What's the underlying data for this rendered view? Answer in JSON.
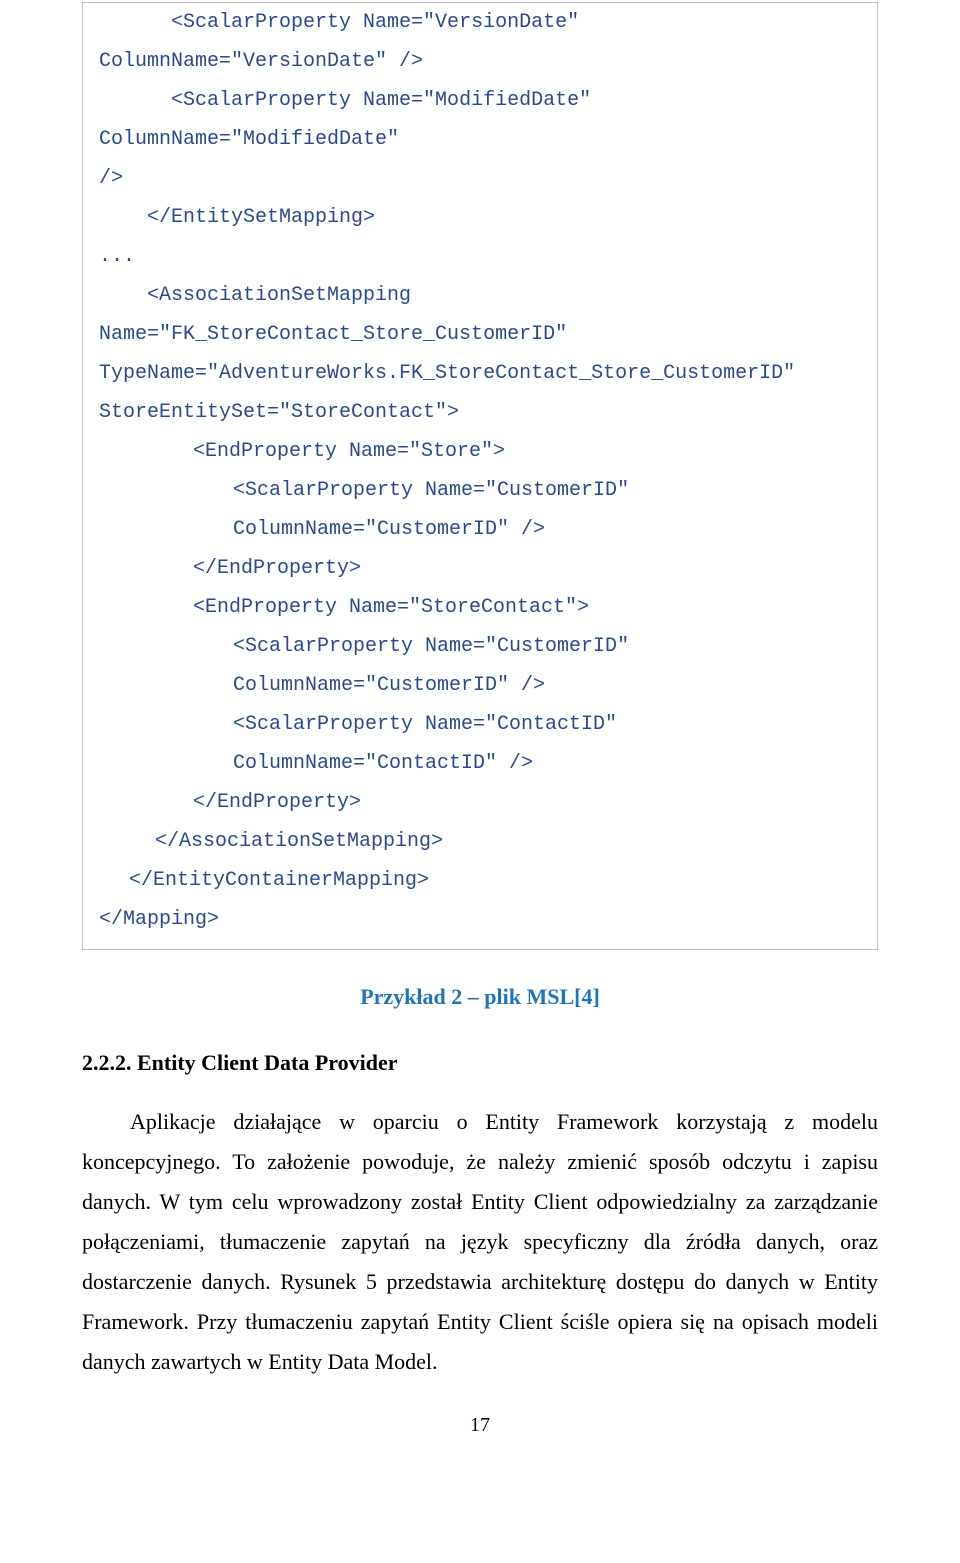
{
  "xml": {
    "l1": "      <ScalarProperty Name=\"VersionDate\" ColumnName=\"VersionDate\" />",
    "l2": "      <ScalarProperty Name=\"ModifiedDate\" ColumnName=\"ModifiedDate\"",
    "l3": "/>",
    "l4": "    </EntitySetMapping>",
    "l5": "...",
    "l6": "    <AssociationSetMapping Name=\"FK_StoreContact_Store_CustomerID\"",
    "l7": "TypeName=\"AdventureWorks.FK_StoreContact_Store_CustomerID\"",
    "l8": "StoreEntitySet=\"StoreContact\">",
    "l9": "<EndProperty Name=\"Store\">",
    "l10": "<ScalarProperty Name=\"CustomerID\" ColumnName=\"CustomerID\" />",
    "l11": "</EndProperty>",
    "l12": "<EndProperty Name=\"StoreContact\">",
    "l13": "<ScalarProperty Name=\"CustomerID\" ColumnName=\"CustomerID\" />",
    "l14": "<ScalarProperty Name=\"ContactID\" ColumnName=\"ContactID\" />",
    "l15": "</EndProperty>",
    "l16": "</AssociationSetMapping>",
    "l17": "</EntityContainerMapping>",
    "l18": "</Mapping>"
  },
  "caption": "Przykład 2 – plik MSL[4]",
  "heading": "2.2.2. Entity Client Data Provider",
  "paragraph": "Aplikacje działające w oparciu o Entity Framework korzystają z modelu koncepcyjnego. To założenie powoduje, że należy zmienić sposób odczytu i zapisu danych. W tym celu wprowadzony został Entity Client odpowiedzialny za zarządzanie połączeniami, tłumaczenie zapytań na język specyficzny dla źródła danych, oraz dostarczenie danych. Rysunek 5 przedstawia architekturę dostępu do danych w Entity Framework. Przy tłumaczeniu zapytań Entity Client ściśle opiera się na opisach modeli danych zawartych w Entity Data Model.",
  "page_number": "17"
}
